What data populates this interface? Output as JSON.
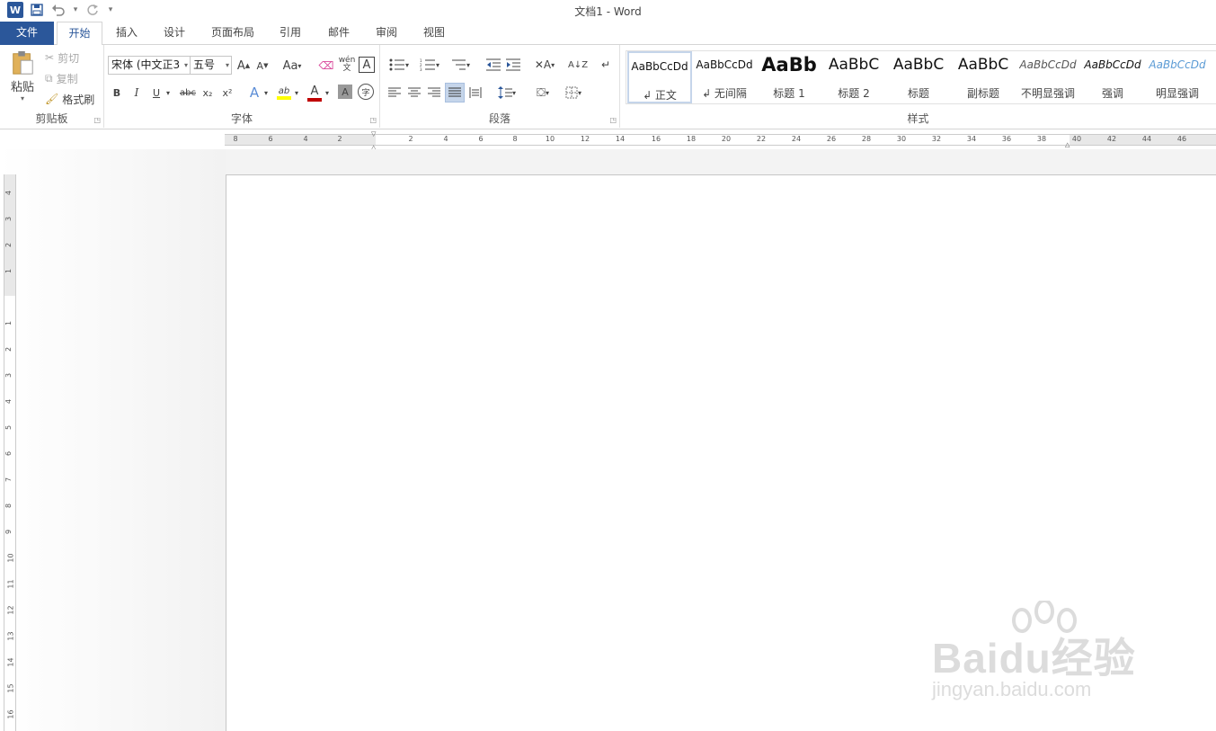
{
  "window": {
    "title": "文档1 - Word"
  },
  "qat": {
    "logo": "W",
    "dropdown": "▾"
  },
  "tabs": [
    {
      "label": "文件"
    },
    {
      "label": "开始"
    },
    {
      "label": "插入"
    },
    {
      "label": "设计"
    },
    {
      "label": "页面布局"
    },
    {
      "label": "引用"
    },
    {
      "label": "邮件"
    },
    {
      "label": "审阅"
    },
    {
      "label": "视图"
    }
  ],
  "clipboard": {
    "paste": "粘贴",
    "cut": "剪切",
    "copy": "复制",
    "format_painter": "格式刷",
    "label": "剪贴板"
  },
  "font": {
    "name": "宋体 (中文正3",
    "size": "五号",
    "label": "字体",
    "grow": "A",
    "shrink": "A",
    "case": "Aa",
    "bold": "B",
    "italic": "I",
    "underline": "U",
    "strike": "abc",
    "sub": "x₂",
    "sup": "x²",
    "pinyin": "wén\n文",
    "border": "A",
    "effects": "A",
    "highlight": "ab",
    "color": "A",
    "shade": "A",
    "enclose": "字"
  },
  "paragraph": {
    "label": "段落"
  },
  "styles": {
    "label": "样式",
    "items": [
      {
        "sample": "AaBbCcDd",
        "name": "↲ 正文"
      },
      {
        "sample": "AaBbCcDd",
        "name": "↲ 无间隔"
      },
      {
        "sample": "AaBb",
        "name": "标题 1"
      },
      {
        "sample": "AaBbC",
        "name": "标题 2"
      },
      {
        "sample": "AaBbC",
        "name": "标题"
      },
      {
        "sample": "AaBbC",
        "name": "副标题"
      },
      {
        "sample": "AaBbCcDd",
        "name": "不明显强调"
      },
      {
        "sample": "AaBbCcDd",
        "name": "强调"
      },
      {
        "sample": "AaBbCcDd",
        "name": "明显强调"
      }
    ]
  },
  "ruler": {
    "corner": "L",
    "h_numbers": [
      "8",
      "6",
      "4",
      "2",
      "2",
      "4",
      "6",
      "8",
      "10",
      "12",
      "14",
      "16",
      "18",
      "20",
      "22",
      "24",
      "26",
      "28",
      "30",
      "32",
      "34",
      "36",
      "38",
      "40",
      "42",
      "44",
      "46"
    ],
    "v_numbers": [
      "4",
      "3",
      "2",
      "1",
      "1",
      "2",
      "3",
      "4",
      "5",
      "6",
      "7",
      "8",
      "9",
      "10",
      "11",
      "12",
      "13",
      "14",
      "15",
      "16"
    ]
  },
  "watermark": {
    "line1": "Baidu经验",
    "line2": "jingyan.baidu.com"
  },
  "colors": {
    "accent": "#2b579a",
    "highlight": "#ffff00",
    "font_color": "#c00000"
  }
}
